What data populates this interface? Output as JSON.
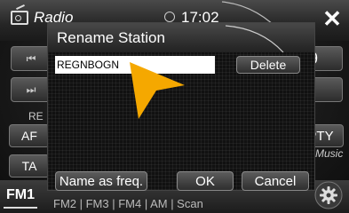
{
  "header": {
    "app_title": "Radio",
    "time": "17:02",
    "close_glyph": "✕"
  },
  "background": {
    "prev_glyph": "⏮",
    "next_glyph": "⏭",
    "re_label": "RE",
    "af_label": "AF",
    "ta_label": "TA",
    "freq_fragment": ".9",
    "pty_label": "PTY",
    "music_fragment": "p Music"
  },
  "bottom": {
    "band_tab": "FM1",
    "partial_tabs": "FM2 | FM3 | FM4 | AM | Scan"
  },
  "dialog": {
    "title": "Rename Station",
    "input_value": "REGNBOGN",
    "delete_label": "Delete",
    "name_as_freq_label": "Name as freq.",
    "ok_label": "OK",
    "cancel_label": "Cancel"
  },
  "colors": {
    "pointer": "#f5a800",
    "accent": "#ffffff"
  },
  "icons": [
    "radio-icon",
    "clock-icon",
    "close-icon",
    "gear-icon",
    "pointer-arrow-icon"
  ]
}
